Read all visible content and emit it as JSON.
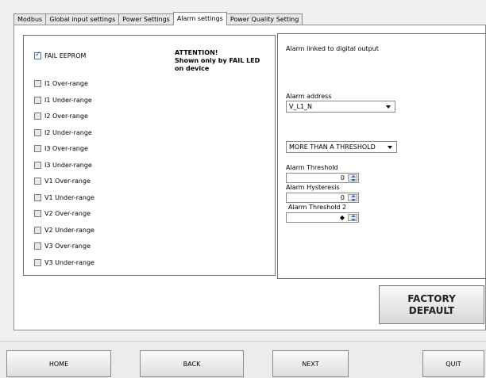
{
  "tabs": [
    {
      "label": "Modbus"
    },
    {
      "label": "Global input settings"
    },
    {
      "label": "Power Settings"
    },
    {
      "label": "Alarm settings"
    },
    {
      "label": "Power Quality Setting"
    }
  ],
  "alarms": {
    "fail_eeprom": {
      "label": "FAIL EEPROM",
      "checked": true
    },
    "items": [
      {
        "label": "I1 Over-range"
      },
      {
        "label": "I1 Under-range"
      },
      {
        "label": "I2 Over-range"
      },
      {
        "label": "I2 Under-range"
      },
      {
        "label": "I3 Over-range"
      },
      {
        "label": "I3 Under-range"
      },
      {
        "label": "V1 Over-range"
      },
      {
        "label": "V1 Under-range"
      },
      {
        "label": "V2 Over-range"
      },
      {
        "label": "V2 Under-range"
      },
      {
        "label": "V3 Over-range"
      },
      {
        "label": "V3 Under-range"
      }
    ],
    "attention": {
      "line1": "ATTENTION!",
      "line2": "Shown only by FAIL LED",
      "line3": "on device"
    }
  },
  "right_panel": {
    "title": "Alarm linked to digital output",
    "address_label": "Alarm address",
    "address_value": "V_L1_N",
    "mode_value": "MORE THAN A THRESHOLD",
    "threshold_label": "Alarm Threshold",
    "threshold_value": "0",
    "hysteresis_label": "Alarm Hysteresis",
    "hysteresis_value": "0",
    "threshold2_label": "Alarm Threshold 2",
    "threshold2_value": "◆"
  },
  "factory_default": {
    "line1": "FACTORY",
    "line2": "DEFAULT"
  },
  "nav": {
    "home": "HOME",
    "back": "BACK",
    "next": "NEXT",
    "quit": "QUIT"
  }
}
